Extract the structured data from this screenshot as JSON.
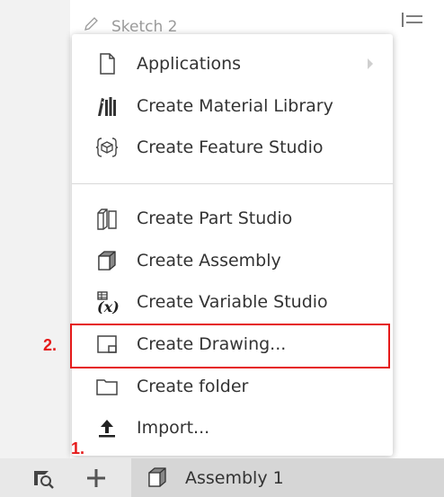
{
  "feature_list": {
    "sketch_label": "Sketch 2"
  },
  "menu": {
    "items": [
      {
        "label": "Applications",
        "icon": "document-icon",
        "has_submenu": true
      },
      {
        "label": "Create Material Library",
        "icon": "material-library-icon"
      },
      {
        "label": "Create Feature Studio",
        "icon": "feature-studio-icon"
      },
      {
        "label": "Create Part Studio",
        "icon": "part-studio-icon"
      },
      {
        "label": "Create Assembly",
        "icon": "assembly-icon"
      },
      {
        "label": "Create Variable Studio",
        "icon": "variable-studio-icon"
      },
      {
        "label": "Create Drawing...",
        "icon": "drawing-icon"
      },
      {
        "label": "Create folder",
        "icon": "folder-icon"
      },
      {
        "label": "Import...",
        "icon": "upload-icon"
      }
    ]
  },
  "annotations": {
    "step1": "1.",
    "step2": "2."
  },
  "tabs": [
    {
      "label": "Assembly 1",
      "icon": "assembly-icon"
    }
  ],
  "colors": {
    "highlight": "#e51a1a",
    "tab_bar": "#e8e8e8",
    "active_tab": "#d6d6d6"
  }
}
